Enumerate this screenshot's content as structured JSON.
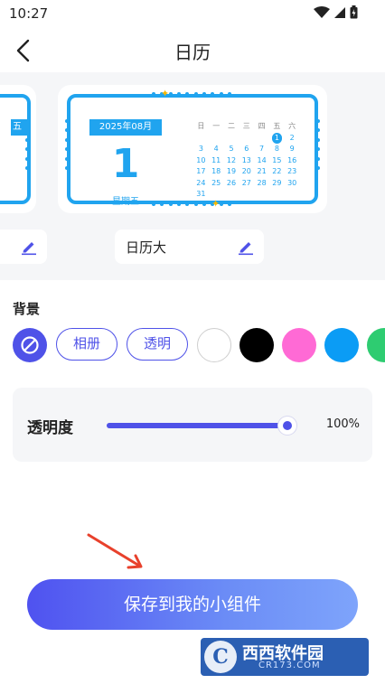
{
  "status_bar": {
    "time": "10:27",
    "icons": [
      "wifi-icon",
      "signal-icon",
      "battery-icon"
    ]
  },
  "header": {
    "title": "日历",
    "back_icon": "back-arrow-icon"
  },
  "widget_preview": {
    "partial_card": {
      "badge_text": "五"
    },
    "main_card": {
      "date_badge": "2025年08月",
      "big_day": "1",
      "weekday": "星期五",
      "calendar_header": [
        "日",
        "一",
        "二",
        "三",
        "四",
        "五",
        "六"
      ],
      "calendar_weeks": [
        [
          "",
          "",
          "",
          "",
          "",
          "1",
          "2"
        ],
        [
          "3",
          "4",
          "5",
          "6",
          "7",
          "8",
          "9"
        ],
        [
          "10",
          "11",
          "12",
          "13",
          "14",
          "15",
          "16"
        ],
        [
          "17",
          "18",
          "19",
          "20",
          "21",
          "22",
          "23"
        ],
        [
          "24",
          "25",
          "26",
          "27",
          "28",
          "29",
          "30"
        ],
        [
          "31",
          "",
          "",
          "",
          "",
          "",
          ""
        ]
      ],
      "today": "1",
      "accent_color": "#20a4ef"
    },
    "main_name": "日历大",
    "edit_icon": "pencil-icon"
  },
  "background": {
    "label": "背景",
    "none_icon": "no-background-icon",
    "album_label": "相册",
    "transparent_label": "透明",
    "swatches": [
      "#ffffff",
      "#000000",
      "#ff6ad5",
      "#0b9cf5",
      "#2ecc71"
    ]
  },
  "opacity": {
    "label": "透明度",
    "value_text": "100%",
    "value": 1.0
  },
  "save_button": {
    "label": "保存到我的小组件"
  },
  "watermark": {
    "logo_letter": "C",
    "text": "西西软件园",
    "sub": "CR173.COM"
  },
  "colors": {
    "primary": "#4f52e8",
    "calendar_blue": "#20a4ef",
    "sparkle": "#f5b800",
    "arrow": "#e8412c"
  }
}
